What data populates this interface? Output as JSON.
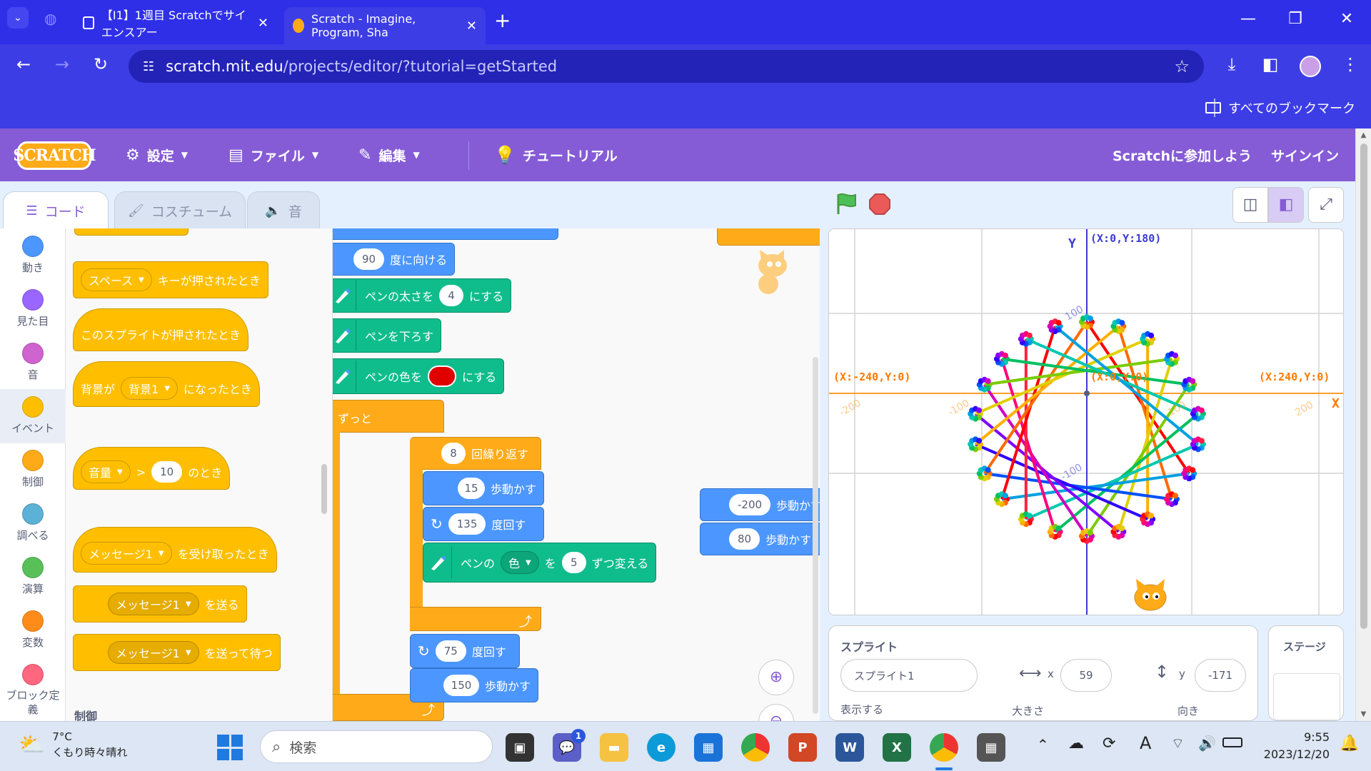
{
  "browser": {
    "tabs": [
      {
        "title": "【I1】1週目 Scratchでサイエンスアー"
      },
      {
        "title": "Scratch - Imagine, Program, Sha"
      }
    ],
    "new_tab": "+",
    "url_host": "scratch.mit.edu",
    "url_path": "/projects/editor/?tutorial=getStarted",
    "bookmarks_all": "すべてのブックマーク"
  },
  "menu": {
    "logo": "SCRATCH",
    "settings": "設定",
    "file": "ファイル",
    "edit": "編集",
    "tutorial": "チュートリアル",
    "join": "Scratchに参加しよう",
    "signin": "サインイン"
  },
  "editor_tabs": {
    "code": "コード",
    "costumes": "コスチューム",
    "sounds": "音"
  },
  "categories": [
    {
      "label": "動き",
      "color": "#4c97ff"
    },
    {
      "label": "見た目",
      "color": "#9966ff"
    },
    {
      "label": "音",
      "color": "#cf63cf"
    },
    {
      "label": "イベント",
      "color": "#ffbf00"
    },
    {
      "label": "制御",
      "color": "#ffab19"
    },
    {
      "label": "調べる",
      "color": "#5cb1d6"
    },
    {
      "label": "演算",
      "color": "#59c059"
    },
    {
      "label": "変数",
      "color": "#ff8c1a"
    },
    {
      "label": "ブロック定義",
      "color": "#ff6680"
    }
  ],
  "palette": {
    "key_dropdown": "スペース",
    "key_pressed": "キーが押されたとき",
    "sprite_clicked": "このスプライトが押されたとき",
    "backdrop_prefix": "背景が",
    "backdrop_dropdown": "背景1",
    "backdrop_suffix": "になったとき",
    "loudness_dropdown": "音量",
    "gt": ">",
    "loudness_value": "10",
    "loudness_suffix": "のとき",
    "msg_dropdown": "メッセージ1",
    "msg_received": "を受け取ったとき",
    "msg_broadcast": "を送る",
    "msg_broadcast_wait": "を送って待つ",
    "section_control": "制御"
  },
  "script": {
    "point_value": "90",
    "point_label": "度に向ける",
    "pen_size_label": "ペンの太さを",
    "pen_size_value": "4",
    "pen_size_suffix": "にする",
    "pen_down": "ペンを下ろす",
    "pen_color_label": "ペンの色を",
    "pen_color_suffix": "にする",
    "pen_color": "#e00000",
    "forever": "ずっと",
    "repeat_value": "8",
    "repeat_label": "回繰り返す",
    "move1_value": "15",
    "move_label": "歩動かす",
    "turn1_value": "135",
    "turn_label": "度回す",
    "change_prefix": "ペンの",
    "change_dropdown": "色",
    "change_mid": "を",
    "change_value": "5",
    "change_suffix": "ずつ変える",
    "turn2_value": "75",
    "move2_value": "150",
    "loose_move1_value": "-200",
    "loose_move2_value": "80",
    "loose_move_label": "歩動かす"
  },
  "stage": {
    "label_top": "(X:0,Y:180)",
    "label_left": "(X:-240,Y:0)",
    "label_center": "(X:0,Y:0)",
    "label_right": "(X:240,Y:0)",
    "axis_x": "X",
    "axis_y": "Y",
    "tick_x": [
      "-200",
      "-100",
      "100",
      "200"
    ],
    "tick_y": [
      "100",
      "-100"
    ]
  },
  "sprite_info": {
    "sprite_heading": "スプライト",
    "name": "スプライト1",
    "x_label": "x",
    "x_value": "59",
    "y_label": "y",
    "y_value": "-171",
    "show_label": "表示する",
    "size_label": "大きさ",
    "direction_label": "向き",
    "stage_heading": "ステージ"
  },
  "taskbar": {
    "temp": "7°C",
    "weather": "くもり時々晴れ",
    "search": "検索",
    "time": "9:55",
    "date": "2023/12/20",
    "chat_badge": "1"
  }
}
